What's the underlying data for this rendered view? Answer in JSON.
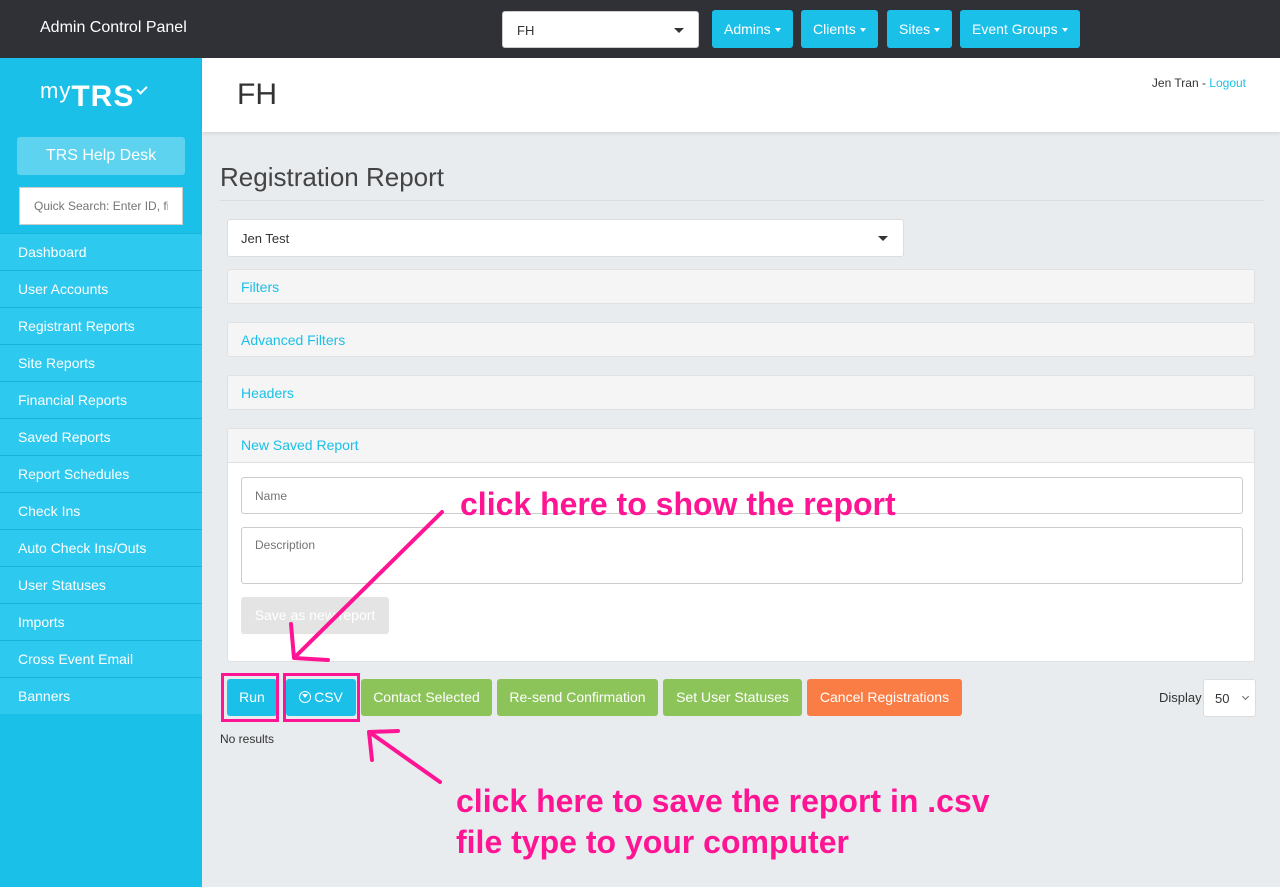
{
  "topbar": {
    "app_title": "Admin Control Panel",
    "client_selected": "FH",
    "menus": [
      "Admins",
      "Clients",
      "Sites",
      "Event Groups"
    ]
  },
  "sidebar": {
    "logo_prefix": "my",
    "logo_main": "TRS",
    "help_label": "TRS Help Desk",
    "search_placeholder": "Quick Search: Enter ID, first",
    "items": [
      "Dashboard",
      "User Accounts",
      "Registrant Reports",
      "Site Reports",
      "Financial Reports",
      "Saved Reports",
      "Report Schedules",
      "Check Ins",
      "Auto Check Ins/Outs",
      "User Statuses",
      "Imports",
      "Cross Event Email",
      "Banners"
    ]
  },
  "header": {
    "page_title": "FH",
    "user_name": "Jen Tran",
    "separator": " - ",
    "logout_label": "Logout"
  },
  "main": {
    "report_title": "Registration Report",
    "report_selected": "Jen Test",
    "panels": [
      "Filters",
      "Advanced Filters",
      "Headers"
    ],
    "new_report": {
      "title": "New Saved Report",
      "name_placeholder": "Name",
      "description_placeholder": "Description",
      "save_label": "Save as new report"
    },
    "actions": {
      "run": "Run",
      "csv": "CSV",
      "contact": "Contact Selected",
      "resend": "Re-send Confirmation",
      "set_status": "Set User Statuses",
      "cancel": "Cancel Registrations"
    },
    "display_label": "Display",
    "display_value": "50",
    "no_results": "No results"
  },
  "annotations": {
    "run_note": "click here to show the report",
    "csv_note_line1": "click here to save the report in .csv",
    "csv_note_line2": "file type to your computer"
  },
  "colors": {
    "accent": "#1bc0e8",
    "topbar": "#2f3136",
    "green": "#8cc45a",
    "orange": "#fa7d45",
    "annotation": "#ff1493"
  }
}
